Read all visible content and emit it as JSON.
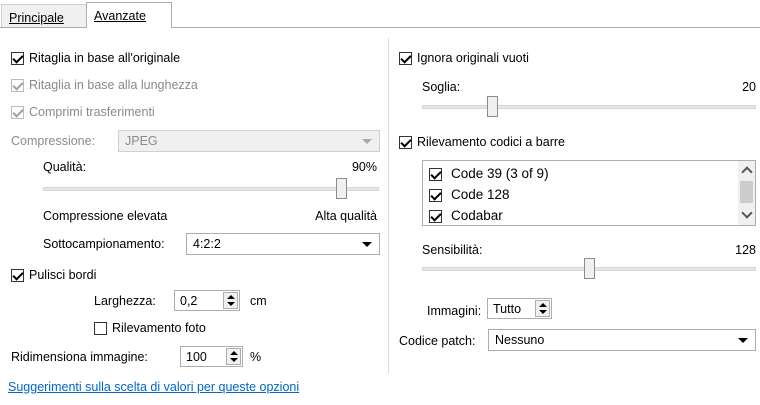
{
  "tabs": [
    {
      "label": "Principale",
      "active": false
    },
    {
      "label": "Avanzate",
      "active": true
    }
  ],
  "left": {
    "crop_original": {
      "label": "Ritaglia in base all'originale",
      "checked": true,
      "enabled": true
    },
    "crop_length": {
      "label": "Ritaglia in base alla lunghezza",
      "checked": true,
      "enabled": false
    },
    "compress_transfers": {
      "label": "Comprimi trasferimenti",
      "checked": true,
      "enabled": false
    },
    "compression": {
      "label": "Compressione:",
      "value": "JPEG",
      "enabled": false
    },
    "quality": {
      "label": "Qualità:",
      "value_text": "90%",
      "fraction": 0.9,
      "min_label": "Compressione elevata",
      "max_label": "Alta qualità"
    },
    "subsampling": {
      "label": "Sottocampionamento:",
      "value": "4:2:2"
    },
    "clean_edges": {
      "label": "Pulisci bordi",
      "checked": true
    },
    "width": {
      "label": "Larghezza:",
      "value": "0,2",
      "unit": "cm"
    },
    "photo_detection": {
      "label": "Rilevamento foto",
      "checked": false
    },
    "resize": {
      "label": "Ridimensiona immagine:",
      "value": "100",
      "unit": "%"
    },
    "help_link": "Suggerimenti sulla scelta di valori per queste opzioni"
  },
  "right": {
    "ignore_blank": {
      "label": "Ignora originali vuoti",
      "checked": true
    },
    "threshold": {
      "label": "Soglia:",
      "value": "20",
      "fraction": 0.2
    },
    "barcode": {
      "label": "Rilevamento codici a barre",
      "checked": true
    },
    "barcode_types": [
      {
        "label": "Code 39 (3 of 9)",
        "checked": true
      },
      {
        "label": "Code 128",
        "checked": true
      },
      {
        "label": "Codabar",
        "checked": true
      }
    ],
    "sensitivity": {
      "label": "Sensibilità:",
      "value": "128",
      "fraction": 0.5
    },
    "images": {
      "label": "Immagini:",
      "value": "Tutto"
    },
    "patch_code": {
      "label": "Codice patch:",
      "value": "Nessuno"
    }
  }
}
